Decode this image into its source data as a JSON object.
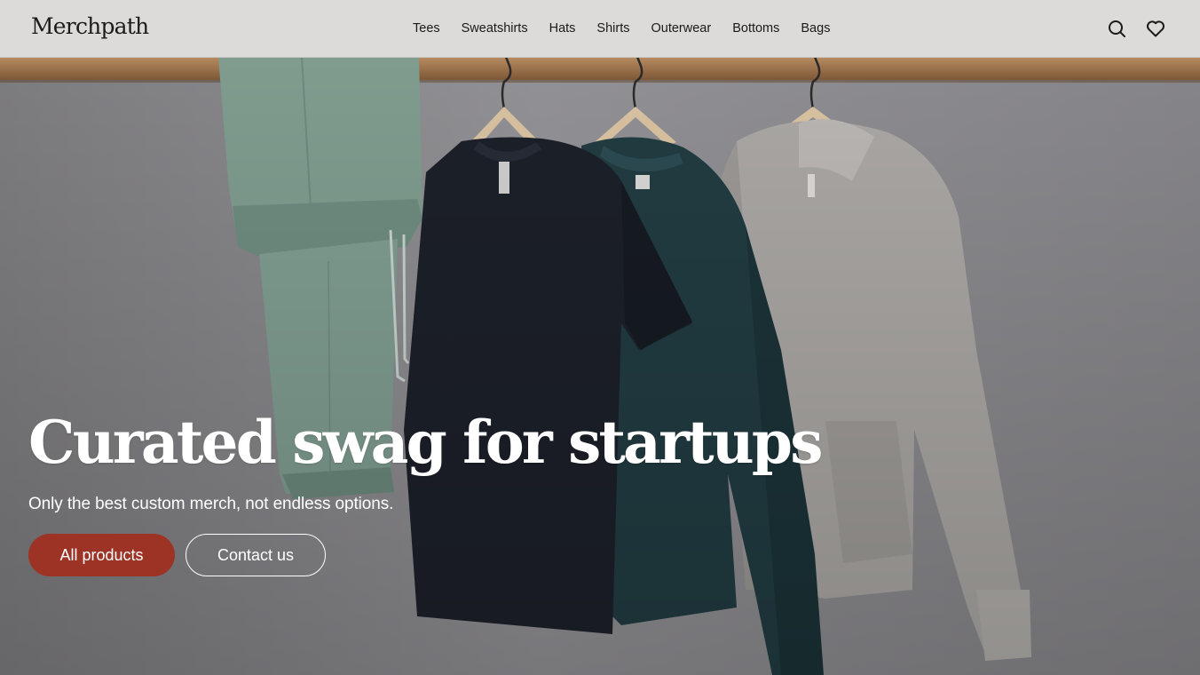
{
  "brand": {
    "name": "Merchpath"
  },
  "nav": {
    "items": [
      {
        "label": "Tees"
      },
      {
        "label": "Sweatshirts"
      },
      {
        "label": "Hats"
      },
      {
        "label": "Shirts"
      },
      {
        "label": "Outerwear"
      },
      {
        "label": "Bottoms"
      },
      {
        "label": "Bags"
      }
    ]
  },
  "header_icons": [
    "search-icon",
    "heart-icon"
  ],
  "hero": {
    "title": "Curated swag for startups",
    "subtitle": "Only the best custom merch, not endless options.",
    "primary_button": "All products",
    "secondary_button": "Contact us"
  },
  "colors": {
    "header_bg": "#dcdbd9",
    "accent": "#9c3325",
    "hero_wall": "#8d8c8f",
    "rail_wood": "#9a6f47",
    "sage_pants": "#7f9c8f",
    "navy_tee": "#1b1f28",
    "teal_sweatshirt": "#1f3a40",
    "grey_hoodie": "#a9a6a3"
  }
}
